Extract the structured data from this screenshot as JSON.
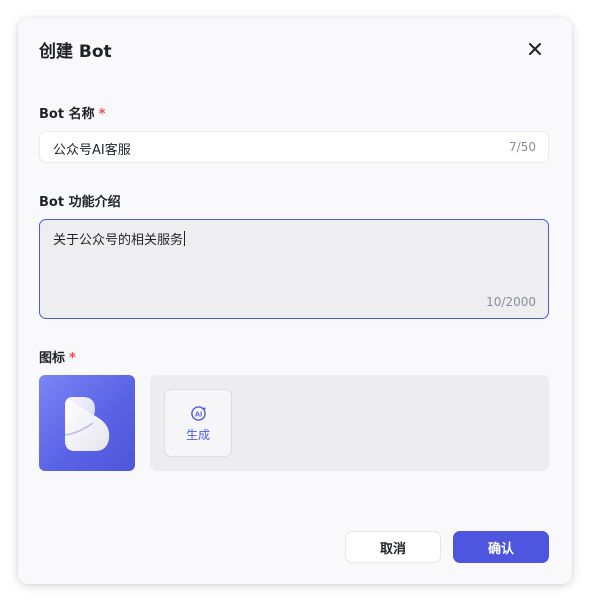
{
  "dialog": {
    "title": "创建 Bot",
    "close_icon": "close-icon"
  },
  "name_field": {
    "label": "Bot 名称",
    "required_mark": "*",
    "value": "公众号AI客服",
    "counter": "7/50"
  },
  "description_field": {
    "label": "Bot 功能介绍",
    "value": "关于公众号的相关服务",
    "counter": "10/2000"
  },
  "icon_field": {
    "label": "图标",
    "required_mark": "*",
    "preview_icon": "bot-b-logo-icon",
    "generate_icon": "ai-sparkle-icon",
    "generate_label": "生成"
  },
  "actions": {
    "cancel_label": "取消",
    "confirm_label": "确认"
  },
  "colors": {
    "accent": "#4e56e0",
    "required": "#f5474d",
    "dialog_background": "#f9f9fb"
  }
}
